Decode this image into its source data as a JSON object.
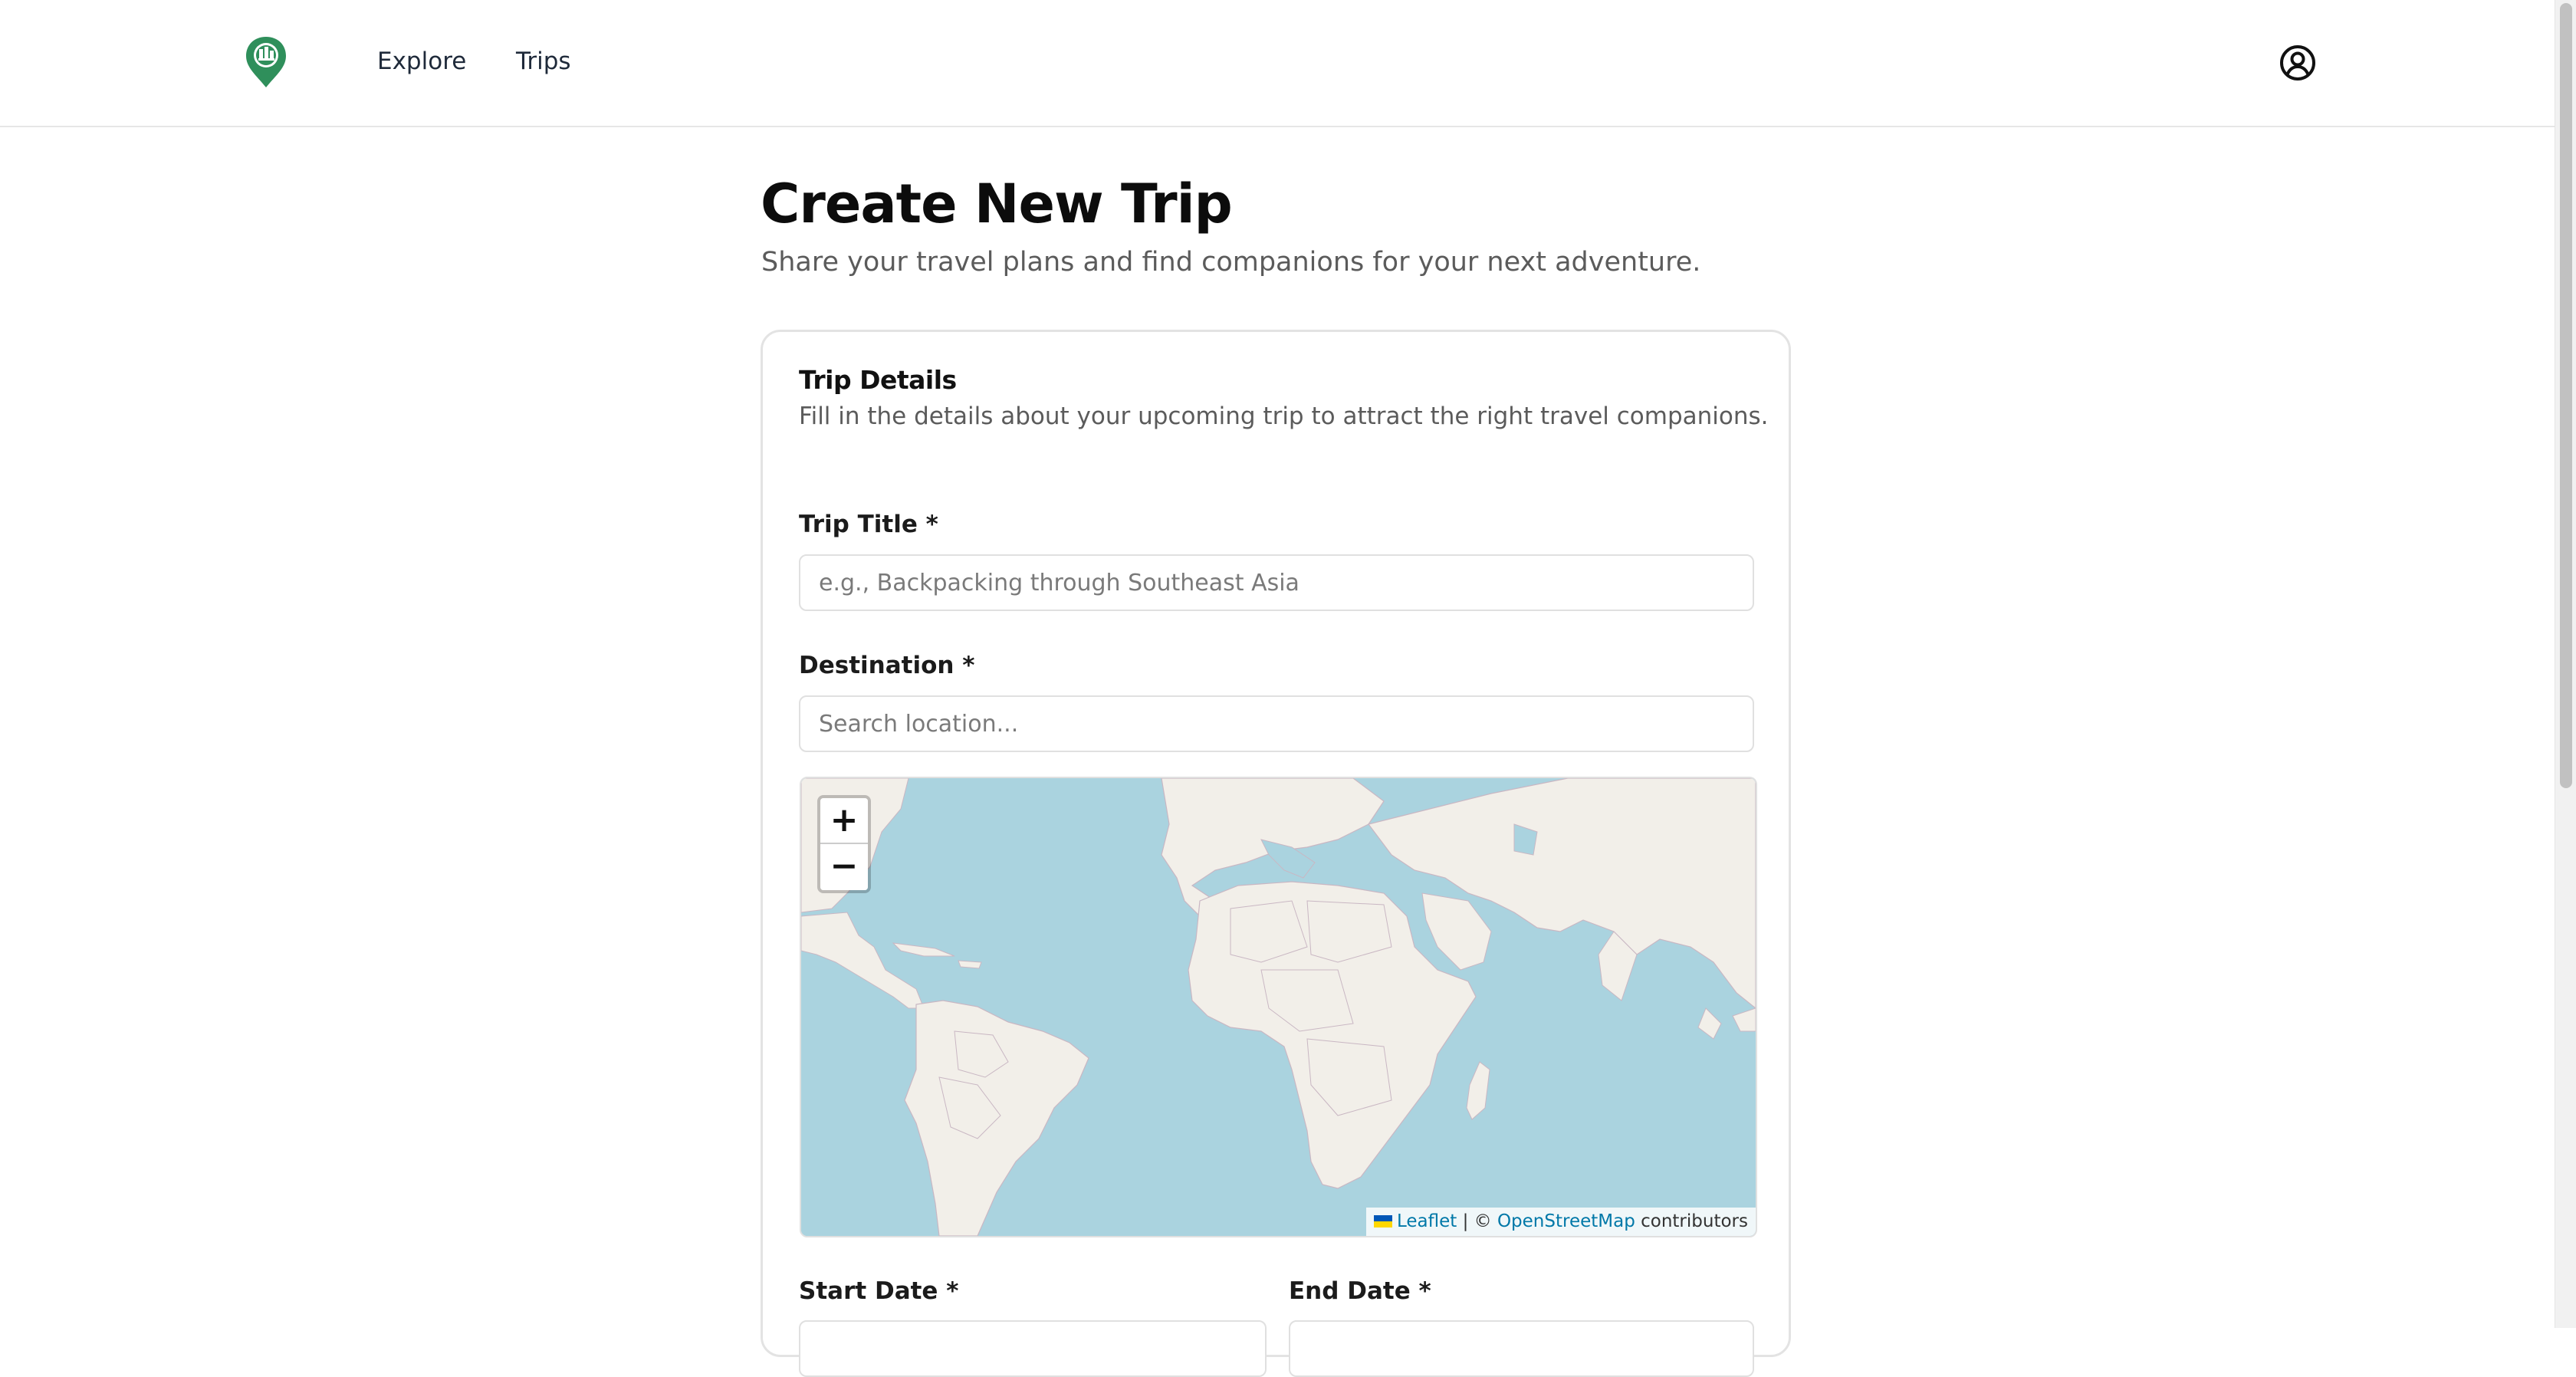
{
  "header": {
    "nav": {
      "explore": "Explore",
      "trips": "Trips"
    }
  },
  "page": {
    "title": "Create New Trip",
    "subtitle": "Share your travel plans and find companions for your next adventure."
  },
  "card": {
    "title": "Trip Details",
    "description": "Fill in the details about your upcoming trip to attract the right travel companions."
  },
  "form": {
    "trip_title": {
      "label": "Trip Title *",
      "value": "",
      "placeholder": "e.g., Backpacking through Southeast Asia"
    },
    "destination": {
      "label": "Destination *",
      "value": "",
      "placeholder": "Search location..."
    },
    "start_date": {
      "label": "Start Date *",
      "value": ""
    },
    "end_date": {
      "label": "End Date *",
      "value": ""
    }
  },
  "map": {
    "zoom_in": "+",
    "zoom_out": "−",
    "attribution": {
      "leaflet": "Leaflet",
      "separator": " | © ",
      "osm": "OpenStreetMap",
      "suffix": " contributors"
    }
  },
  "icons": {
    "logo": "map-pin-logo-icon",
    "avatar": "user-circle-icon"
  },
  "colors": {
    "brand_green": "#2f8f5b",
    "map_water": "#aad3df",
    "map_land": "#f2efe9",
    "link_blue": "#0078a8"
  }
}
